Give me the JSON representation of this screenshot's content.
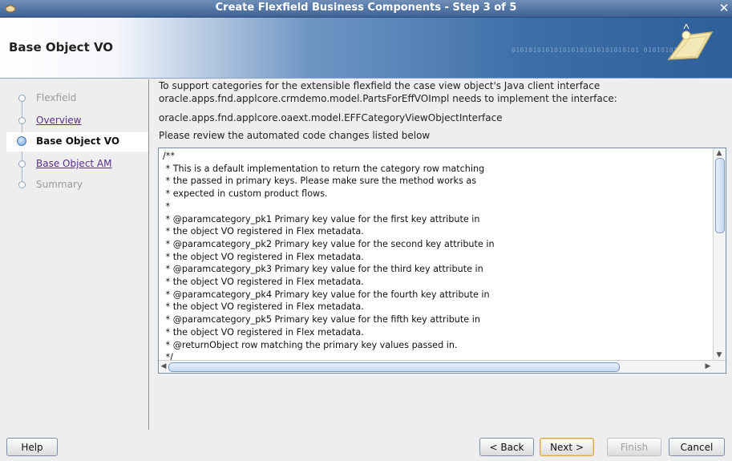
{
  "window": {
    "title": "Create Flexfield Business Components - Step 3 of 5"
  },
  "header": {
    "title": "Base Object VO",
    "pattern_text": "010101010101010101010101010101 01010101010"
  },
  "nav": {
    "steps": [
      {
        "label": "Flexfield",
        "state": "disabled"
      },
      {
        "label": "Overview",
        "state": "link"
      },
      {
        "label": "Base Object VO",
        "state": "current"
      },
      {
        "label": "Base Object AM",
        "state": "link"
      },
      {
        "label": "Summary",
        "state": "disabled"
      }
    ]
  },
  "content": {
    "intro_line1": "To support categories for the extensible flexfield the case view object's Java client interface",
    "intro_line2": "oracle.apps.fnd.applcore.crmdemo.model.PartsForEffVOImpl needs to implement the interface:",
    "interface_name": "oracle.apps.fnd.applcore.oaext.model.EFFCategoryViewObjectInterface",
    "review_note": "Please review the automated code changes listed below",
    "code": "/**\n * This is a default implementation to return the category row matching\n * the passed in primary keys. Please make sure the method works as\n * expected in custom product flows.\n *\n * @paramcategory_pk1 Primary key value for the first key attribute in\n * the object VO registered in Flex metadata.\n * @paramcategory_pk2 Primary key value for the second key attribute in\n * the object VO registered in Flex metadata.\n * @paramcategory_pk3 Primary key value for the third key attribute in\n * the object VO registered in Flex metadata.\n * @paramcategory_pk4 Primary key value for the fourth key attribute in\n * the object VO registered in Flex metadata.\n * @paramcategory_pk5 Primary key value for the fifth key attribute in\n * the object VO registered in Flex metadata.\n * @returnObject row matching the primary key values passed in.\n */"
  },
  "footer": {
    "help_label": "Help",
    "back_label": "< Back",
    "next_label": "Next >",
    "finish_label": "Finish",
    "cancel_label": "Cancel"
  },
  "colors": {
    "accent": "#3d6ea8",
    "link": "#5a2d8c"
  }
}
